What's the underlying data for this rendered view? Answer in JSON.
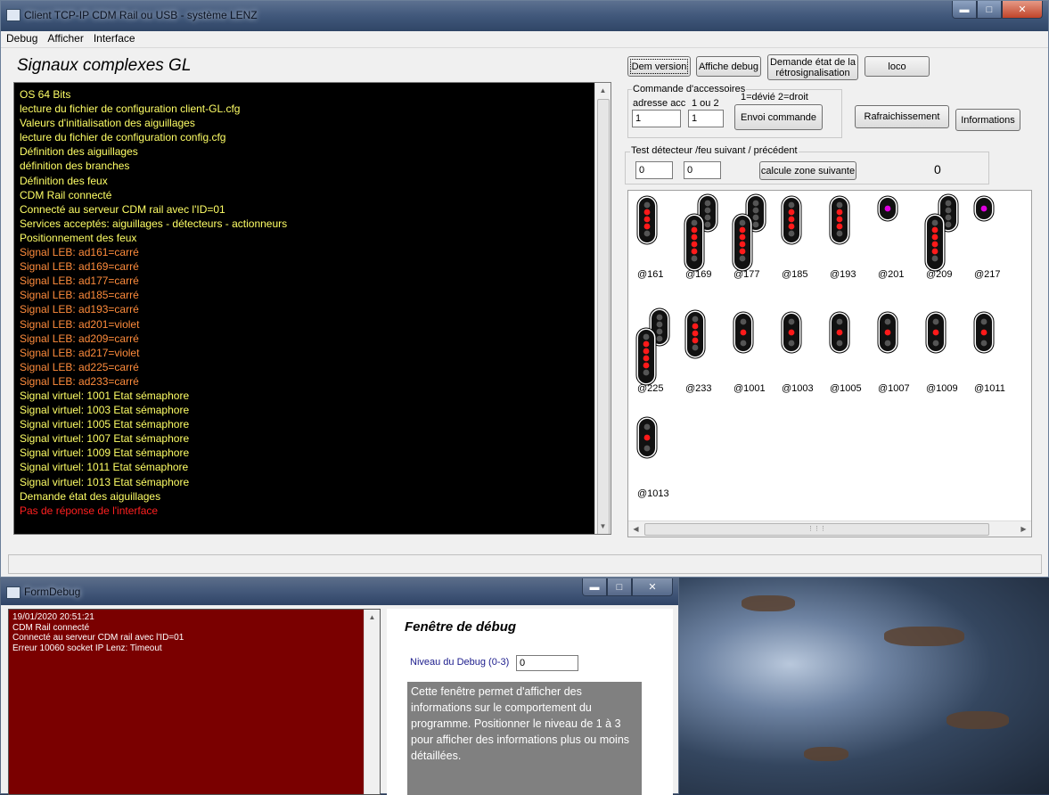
{
  "main_window": {
    "title": "Client TCP-IP CDM Rail ou USB - système LENZ",
    "menu": [
      "Debug",
      "Afficher",
      "Interface"
    ],
    "heading": "Signaux complexes GL"
  },
  "log": {
    "lines": [
      {
        "text": "OS 64 Bits",
        "color": "#ffff66"
      },
      {
        "text": "lecture du fichier de configuration client-GL.cfg",
        "color": "#ffff66"
      },
      {
        "text": "Valeurs d'initialisation des aiguillages",
        "color": "#ffff66"
      },
      {
        "text": "lecture du fichier de configuration config.cfg",
        "color": "#ffff66"
      },
      {
        "text": "Définition des aiguillages",
        "color": "#ffff66"
      },
      {
        "text": "définition des branches",
        "color": "#ffff66"
      },
      {
        "text": "Définition des feux",
        "color": "#ffff66"
      },
      {
        "text": "CDM Rail connecté",
        "color": "#ffff66"
      },
      {
        "text": "Connecté au serveur CDM rail avec l'ID=01",
        "color": "#ffff66"
      },
      {
        "text": "Services acceptés: aiguillages - détecteurs - actionneurs",
        "color": "#ffff66"
      },
      {
        "text": "Positionnement des feux",
        "color": "#ffff66"
      },
      {
        "text": "Signal LEB:  ad161=carré",
        "color": "#ff8c3c"
      },
      {
        "text": "Signal LEB:  ad169=carré",
        "color": "#ff8c3c"
      },
      {
        "text": "Signal LEB:  ad177=carré",
        "color": "#ff8c3c"
      },
      {
        "text": "Signal LEB:  ad185=carré",
        "color": "#ff8c3c"
      },
      {
        "text": "Signal LEB:  ad193=carré",
        "color": "#ff8c3c"
      },
      {
        "text": "Signal LEB:  ad201=violet",
        "color": "#ff8c3c"
      },
      {
        "text": "Signal LEB:  ad209=carré",
        "color": "#ff8c3c"
      },
      {
        "text": "Signal LEB:  ad217=violet",
        "color": "#ff8c3c"
      },
      {
        "text": "Signal LEB:  ad225=carré",
        "color": "#ff8c3c"
      },
      {
        "text": "Signal LEB:  ad233=carré",
        "color": "#ff8c3c"
      },
      {
        "text": "Signal virtuel: 1001 Etat sémaphore",
        "color": "#ffff66"
      },
      {
        "text": "Signal virtuel: 1003 Etat sémaphore",
        "color": "#ffff66"
      },
      {
        "text": "Signal virtuel: 1005 Etat sémaphore",
        "color": "#ffff66"
      },
      {
        "text": "Signal virtuel: 1007 Etat sémaphore",
        "color": "#ffff66"
      },
      {
        "text": "Signal virtuel: 1009 Etat sémaphore",
        "color": "#ffff66"
      },
      {
        "text": "Signal virtuel: 1011 Etat sémaphore",
        "color": "#ffff66"
      },
      {
        "text": "Signal virtuel: 1013 Etat sémaphore",
        "color": "#ffff66"
      },
      {
        "text": "Demande état des aiguillages",
        "color": "#ffff66"
      },
      {
        "text": "Pas de réponse de l'interface",
        "color": "#ff2020"
      }
    ]
  },
  "buttons": {
    "dem_version": "Dem version",
    "affiche_debug": "Affiche debug",
    "demande_etat": "Demande état de la rétrosignalisation",
    "loco": "loco",
    "envoi_commande": "Envoi commande",
    "rafraichissement": "Rafraichissement",
    "informations": "Informations",
    "calcule_zone": "calcule zone suivante"
  },
  "accessoires": {
    "group_label": "Commande d'accessoires",
    "adresse_label": "adresse acc",
    "choix_label": "1 ou 2",
    "legend": "1=dévié   2=droit",
    "adresse_value": "1",
    "choix_value": "1"
  },
  "detecteur": {
    "group_label": "Test détecteur /feu suivant / précédent",
    "field1": "0",
    "field2": "0",
    "result": "0"
  },
  "signals": [
    {
      "addr": "@161",
      "kind": "tall",
      "lit": "red"
    },
    {
      "addr": "@169",
      "kind": "complex",
      "lit": "red"
    },
    {
      "addr": "@177",
      "kind": "complex",
      "lit": "red"
    },
    {
      "addr": "@185",
      "kind": "tall",
      "lit": "red"
    },
    {
      "addr": "@193",
      "kind": "tall",
      "lit": "red"
    },
    {
      "addr": "@201",
      "kind": "small",
      "lit": "violet"
    },
    {
      "addr": "@209",
      "kind": "complex",
      "lit": "red"
    },
    {
      "addr": "@217",
      "kind": "small",
      "lit": "violet"
    },
    {
      "addr": "@225",
      "kind": "complex",
      "lit": "red"
    },
    {
      "addr": "@233",
      "kind": "tall",
      "lit": "red"
    },
    {
      "addr": "@1001",
      "kind": "mid",
      "lit": "red"
    },
    {
      "addr": "@1003",
      "kind": "mid",
      "lit": "red"
    },
    {
      "addr": "@1005",
      "kind": "mid",
      "lit": "red"
    },
    {
      "addr": "@1007",
      "kind": "mid",
      "lit": "red"
    },
    {
      "addr": "@1009",
      "kind": "mid",
      "lit": "red"
    },
    {
      "addr": "@1011",
      "kind": "mid",
      "lit": "red"
    },
    {
      "addr": "@1013",
      "kind": "mid",
      "lit": "red"
    }
  ],
  "colors": {
    "signal_red": "#ff1a1a",
    "signal_violet": "#e000e0",
    "signal_off": "#555555",
    "log_bg": "#000000",
    "debug_log_bg": "#7a0000"
  },
  "debug_window": {
    "title": "FormDebug",
    "log": [
      "19/01/2020 20:51:21",
      "CDM Rail connecté",
      "Connecté au serveur CDM rail avec l'ID=01",
      "Erreur 10060 socket IP Lenz: Timeout"
    ],
    "heading": "Fenêtre de débug",
    "level_label": "Niveau du Debug (0-3)",
    "level_value": "0",
    "help_text": "Cette fenêtre permet d'afficher des informations sur le comportement du programme. Positionner le niveau de 1 à 3 pour afficher des informations plus ou moins détaillées."
  }
}
